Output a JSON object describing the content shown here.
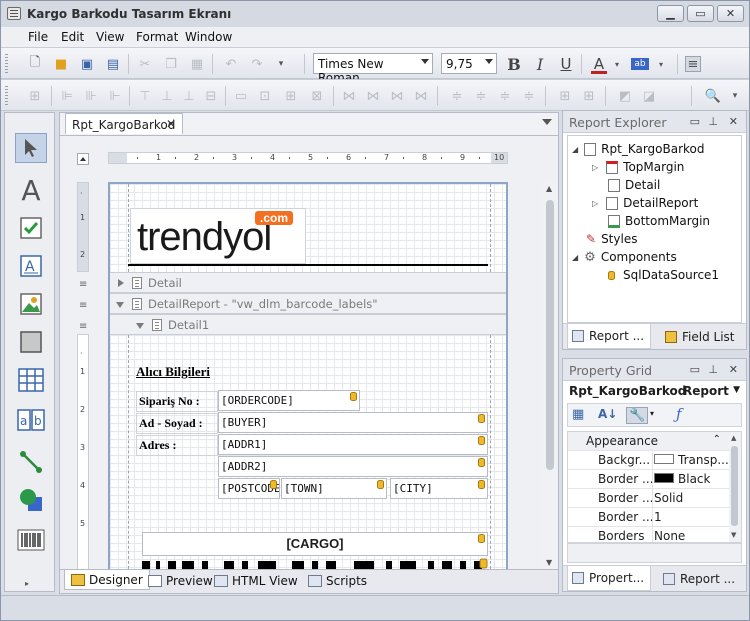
{
  "window": {
    "title": "Kargo Barkodu Tasarım Ekranı"
  },
  "menu": [
    "File",
    "Edit",
    "View",
    "Format",
    "Window"
  ],
  "toolbar": {
    "font_name": "Times New Roman",
    "font_size": "9,75",
    "bold": "B",
    "italic": "I",
    "underline": "U",
    "font_color": "A",
    "highlight": "ab"
  },
  "doc_tab": {
    "label": "Rpt_KargoBarkod"
  },
  "ruler_h": [
    "1",
    "2",
    "3",
    "4",
    "5",
    "6",
    "7",
    "8",
    "9",
    "10"
  ],
  "ruler_v_top": [
    "1",
    "2"
  ],
  "ruler_v_detail": [
    "1",
    "2",
    "3",
    "4",
    "5"
  ],
  "logo": {
    "text": "trendyol",
    "badge": ".com"
  },
  "bands": {
    "detail": "Detail",
    "detail_report": "DetailReport - \"vw_dlm_barcode_labels\"",
    "detail1": "Detail1"
  },
  "form": {
    "heading": "Alıcı Bilgileri",
    "label_order": "Sipariş No :",
    "label_name": "Ad - Soyad :",
    "label_addr": "Adres :",
    "field_order": "[ORDERCODE]",
    "field_buyer": "[BUYER]",
    "field_addr1": "[ADDR1]",
    "field_addr2": "[ADDR2]",
    "field_postcode": "[POSTCODE]",
    "field_town": "[TOWN]",
    "field_city": "[CITY]",
    "cargo": "[CARGO]"
  },
  "bottom_tabs": [
    "Designer",
    "Preview",
    "HTML View",
    "Scripts"
  ],
  "report_explorer": {
    "title": "Report Explorer",
    "items": [
      "Rpt_KargoBarkod",
      "TopMargin",
      "Detail",
      "DetailReport",
      "BottomMargin",
      "Styles",
      "Components",
      "SqlDataSource1"
    ],
    "tabs": [
      "Report ...",
      "Field List"
    ]
  },
  "property_grid": {
    "title": "Property Grid",
    "object_name": "Rpt_KargoBarkod",
    "object_type": "Report",
    "category": "Appearance",
    "rows": [
      {
        "name": "Backgr...",
        "value": "Transp..."
      },
      {
        "name": "Border ...",
        "value": "Black"
      },
      {
        "name": "Border ...",
        "value": "Solid"
      },
      {
        "name": "Border ...",
        "value": "1"
      },
      {
        "name": "Borders",
        "value": "None"
      }
    ],
    "tabs": [
      "Propert...",
      "Report ..."
    ]
  },
  "colors": {
    "accent": "#f36f21",
    "logo_text": "#1a1a1a",
    "db_icon": "#f0b92a"
  }
}
